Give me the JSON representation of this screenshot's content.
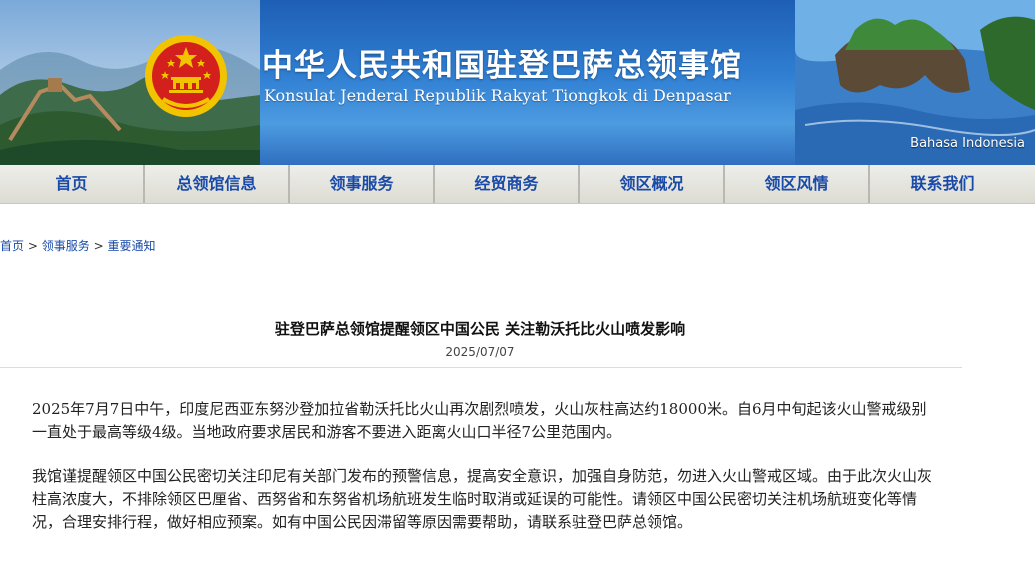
{
  "header": {
    "title_cn": "中华人民共和国驻登巴萨总领事馆",
    "title_id": "Konsulat Jenderal Republik Rakyat Tiongkok di Denpasar",
    "language_link": "Bahasa Indonesia",
    "colors": {
      "banner_blue": "#2f7ed2",
      "emblem_red": "#d4201c",
      "emblem_gold": "#f2c400"
    }
  },
  "nav": {
    "items": [
      {
        "label": "首页"
      },
      {
        "label": "总领馆信息"
      },
      {
        "label": "领事服务"
      },
      {
        "label": "经贸商务"
      },
      {
        "label": "领区概况"
      },
      {
        "label": "领区风情"
      },
      {
        "label": "联系我们"
      }
    ],
    "color": "#1a4aa8"
  },
  "breadcrumb": {
    "items": [
      "首页",
      "领事服务",
      "重要通知"
    ],
    "separator": ">"
  },
  "article": {
    "title": "驻登巴萨总领馆提醒领区中国公民 关注勒沃托比火山喷发影响",
    "date": "2025/07/07",
    "paragraphs": [
      "2025年7月7日中午，印度尼西亚东努沙登加拉省勒沃托比火山再次剧烈喷发，火山灰柱高达约18000米。自6月中旬起该火山警戒级别一直处于最高等级4级。当地政府要求居民和游客不要进入距离火山口半径7公里范围内。",
      "我馆谨提醒领区中国公民密切关注印尼有关部门发布的预警信息，提高安全意识，加强自身防范，勿进入火山警戒区域。由于此次火山灰柱高浓度大，不排除领区巴厘省、西努省和东努省机场航班发生临时取消或延误的可能性。请领区中国公民密切关注机场航班变化等情况，合理安排行程，做好相应预案。如有中国公民因滞留等原因需要帮助，请联系驻登巴萨总领馆。"
    ]
  }
}
